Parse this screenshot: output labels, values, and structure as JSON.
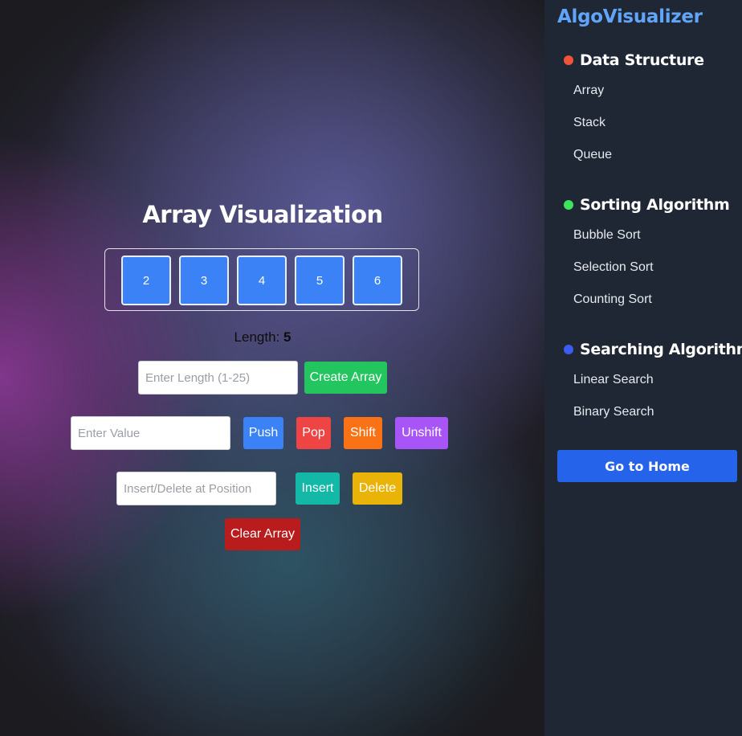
{
  "main": {
    "title": "Array Visualization",
    "array_values": [
      "2",
      "3",
      "4",
      "5",
      "6"
    ],
    "length_label": "Length:",
    "length_value": "5",
    "length_input": {
      "placeholder": "Enter Length (1-25)",
      "value": ""
    },
    "create_button": "Create Array",
    "value_input": {
      "placeholder": "Enter Value",
      "value": ""
    },
    "push_button": "Push",
    "pop_button": "Pop",
    "shift_button": "Shift",
    "unshift_button": "Unshift",
    "position_input": {
      "placeholder": "Insert/Delete at Position",
      "value": ""
    },
    "insert_button": "Insert",
    "delete_button": "Delete",
    "clear_button": "Clear Array"
  },
  "sidebar": {
    "brand": "AlgoVisualizer",
    "sections": [
      {
        "title": "Data Structure",
        "dot_color": "#f0533a",
        "items": [
          "Array",
          "Stack",
          "Queue"
        ]
      },
      {
        "title": "Sorting Algorithm",
        "dot_color": "#3ee45c",
        "items": [
          "Bubble Sort",
          "Selection Sort",
          "Counting Sort"
        ]
      },
      {
        "title": "Searching Algorithm",
        "dot_color": "#3b5cf0",
        "items": [
          "Linear Search",
          "Binary Search"
        ]
      }
    ],
    "home_button": "Go to Home"
  },
  "colors": {
    "array_cell": "#3b82f6",
    "create": "#22c55e",
    "push": "#3b82f6",
    "pop": "#ef4444",
    "shift": "#f97316",
    "unshift": "#a855f7",
    "insert": "#14b8a6",
    "delete": "#eab308",
    "clear": "#b91c1c",
    "home": "#2563eb",
    "brand": "#60a5fa",
    "sidebar_bg": "#1f2735"
  }
}
